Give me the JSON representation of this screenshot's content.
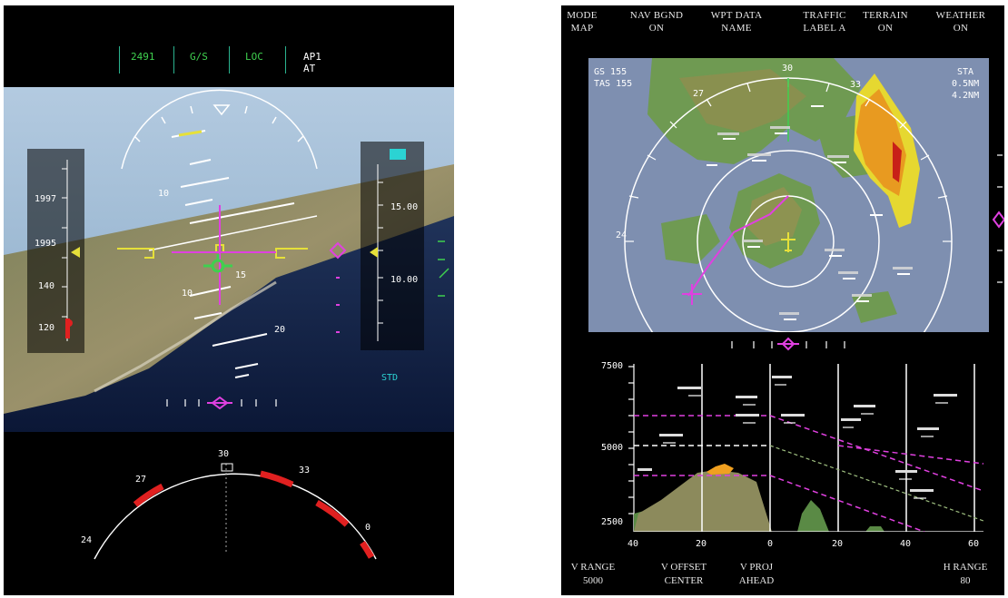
{
  "pfd": {
    "fma": [
      {
        "text": "2491",
        "color": "#3fd04f"
      },
      {
        "text": "G/S",
        "color": "#3fd04f"
      },
      {
        "text": "LOC",
        "color": "#3fd04f"
      }
    ],
    "ap_status": {
      "line1": "AP1",
      "line2": "AT"
    },
    "speed_tape": {
      "labels": [
        "1997",
        "1995",
        "140",
        "120"
      ]
    },
    "altitude_tape": {
      "labels": [
        "15.00",
        "10.00"
      ],
      "baro": "STD"
    },
    "pitch_labels": [
      "10",
      "15",
      "20",
      "10"
    ],
    "heading_arc": {
      "labels": [
        "30",
        "27",
        "33",
        "24",
        "0"
      ]
    }
  },
  "nd": {
    "buttons": [
      {
        "line1": "MODE",
        "line2": "MAP"
      },
      {
        "line1": "NAV BGND",
        "line2": "ON"
      },
      {
        "line1": "WPT DATA",
        "line2": "NAME"
      },
      {
        "line1": "TRAFFIC",
        "line2": "LABEL A"
      },
      {
        "line1": "TERRAIN",
        "line2": "ON"
      },
      {
        "line1": "WEATHER",
        "line2": "ON"
      }
    ],
    "map": {
      "gs_line": "GS  155",
      "tas_line": "TAS  155",
      "right_line1": "STA",
      "right_line2": "0.5NM",
      "right_line3": "4.2NM",
      "compass_labels": [
        "30",
        "33",
        "27",
        "24"
      ]
    },
    "vsd": {
      "alt_labels": [
        "7500",
        "5000",
        "2500"
      ],
      "x_labels": [
        "40",
        "20",
        "0",
        "20",
        "40",
        "60"
      ]
    },
    "bottom": [
      {
        "line1": "V RANGE",
        "line2": "5000"
      },
      {
        "line1": "V OFFSET",
        "line2": "CENTER"
      },
      {
        "line1": "V PROJ",
        "line2": "AHEAD"
      },
      {
        "line1": "H RANGE",
        "line2": "80"
      }
    ]
  }
}
